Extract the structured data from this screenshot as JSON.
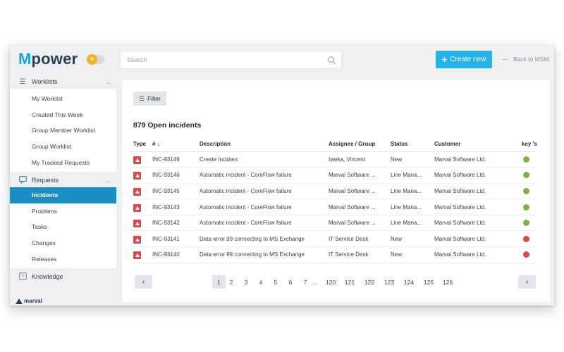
{
  "app": {
    "brand_m": "M",
    "brand_rest": "power"
  },
  "search": {
    "placeholder": "Search",
    "icon": "search-icon"
  },
  "header": {
    "create_label": "Create new",
    "back_label": "Back to MSM"
  },
  "sidebar": {
    "worklists": {
      "label": "Worklists",
      "icon": "list-icon",
      "items": [
        "My Worklist",
        "Created This Week",
        "Group Member Worklist",
        "Group Worklist",
        "My Tracked Requests"
      ]
    },
    "requests": {
      "label": "Requests",
      "icon": "chat-icon",
      "items": [
        "Incidents",
        "Problems",
        "Tasks",
        "Changes",
        "Releases"
      ],
      "active_index": 0
    },
    "knowledge": {
      "label": "Knowledge",
      "icon": "help-icon"
    },
    "footer_logo": "marval"
  },
  "main": {
    "filter_label": "Filter",
    "count_title": "879 Open incidents",
    "columns": {
      "type": "Type",
      "number": "# ↓",
      "description": "Description",
      "assignee": "Assignee / Group",
      "status": "Status",
      "customer": "Customer",
      "kpi": "key 's..."
    },
    "rows": [
      {
        "id": "INC-93149",
        "description": "Create Incident",
        "assignee": "Iweka, Vincent",
        "status": "New",
        "customer": "Marval Software Ltd.",
        "kpi": "green"
      },
      {
        "id": "INC-93146",
        "description": "Automatic incident - CoreFlow failure",
        "assignee": "Marval Software ...",
        "status": "Line Mana...",
        "customer": "Marval Software Ltd.",
        "kpi": "green"
      },
      {
        "id": "INC-93145",
        "description": "Automatic incident - CoreFlow failure",
        "assignee": "Marval Software ...",
        "status": "Line Mana...",
        "customer": "Marval Software Ltd.",
        "kpi": "green"
      },
      {
        "id": "INC-93143",
        "description": "Automatic incident - CoreFlow failure",
        "assignee": "Marval Software ...",
        "status": "Line Mana...",
        "customer": "Marval Software Ltd.",
        "kpi": "green"
      },
      {
        "id": "INC-93142",
        "description": "Automatic incident - CoreFlow failure",
        "assignee": "Marval Software ...",
        "status": "Line Mana...",
        "customer": "Marval Software Ltd.",
        "kpi": "green"
      },
      {
        "id": "INC-93141",
        "description": "Data error 99 connecting to MS Exchange",
        "assignee": "IT Service Desk",
        "status": "New",
        "customer": "Marval Software Ltd.",
        "kpi": "red"
      },
      {
        "id": "INC-93140",
        "description": "Data error 99 connecting to MS Exchange",
        "assignee": "IT Service Desk",
        "status": "New",
        "customer": "Marval Software Ltd.",
        "kpi": "red"
      }
    ],
    "pagination": {
      "pages": [
        "1",
        "2",
        "3",
        "4",
        "5",
        "6",
        "7",
        "...",
        "120",
        "121",
        "122",
        "123",
        "124",
        "125",
        "126"
      ],
      "current": "1"
    }
  },
  "colors": {
    "accent": "#25b4e8",
    "active_nav": "#1a8fc6",
    "incident_type": "#e04747",
    "kpi_green": "#7cb342",
    "kpi_red": "#e04747"
  }
}
